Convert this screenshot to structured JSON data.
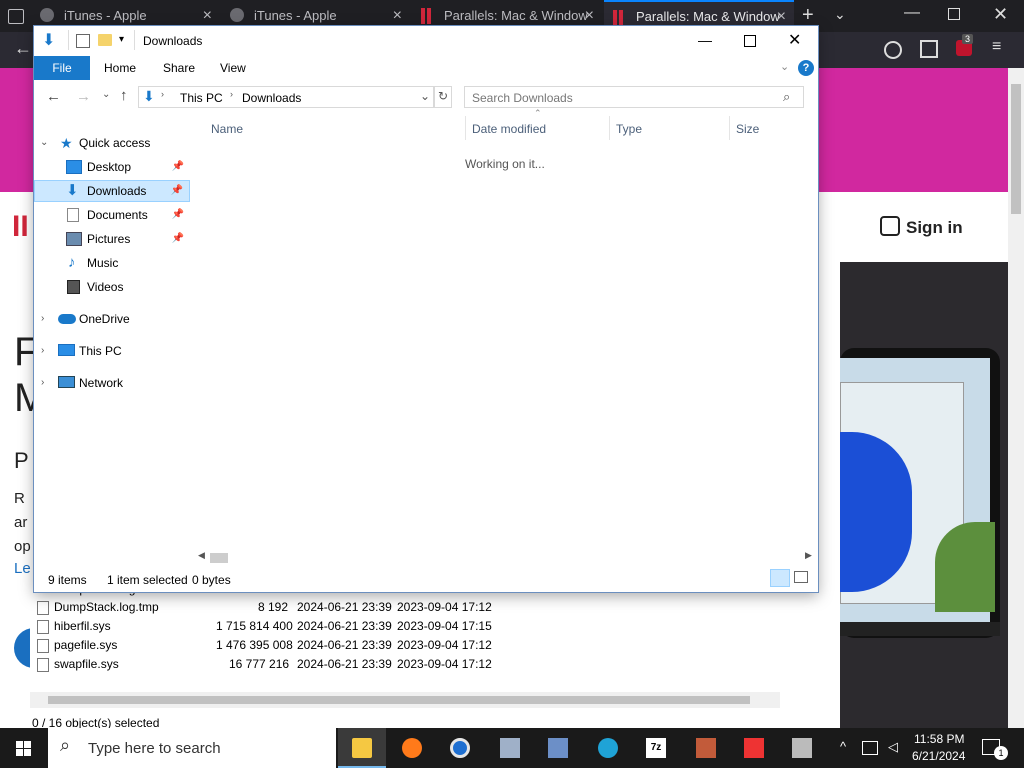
{
  "browser": {
    "tabs": [
      {
        "label": "iTunes - Apple",
        "icon": "apple-icon"
      },
      {
        "label": "iTunes - Apple",
        "icon": "apple-icon"
      },
      {
        "label": "Parallels: Mac & Window",
        "icon": "parallels-icon"
      },
      {
        "label": "Parallels: Mac & Window",
        "icon": "parallels-icon"
      }
    ],
    "badge_count": "3"
  },
  "webpage": {
    "sign_in": "Sign in",
    "left_letters": [
      "F",
      "M",
      "P",
      "R",
      "ar",
      "op",
      "Le"
    ]
  },
  "under_window": {
    "rows": [
      {
        "name": "DumpStack.log",
        "size": "8 192",
        "date1": "2024-06-21 23:39",
        "date2": "2023-09-04 17:12"
      },
      {
        "name": "DumpStack.log.tmp",
        "size": "8 192",
        "date1": "2024-06-21 23:39",
        "date2": "2023-09-04 17:12"
      },
      {
        "name": "hiberfil.sys",
        "size": "1 715 814 400",
        "date1": "2024-06-21 23:39",
        "date2": "2023-09-04 17:15"
      },
      {
        "name": "pagefile.sys",
        "size": "1 476 395 008",
        "date1": "2024-06-21 23:39",
        "date2": "2023-09-04 17:12"
      },
      {
        "name": "swapfile.sys",
        "size": "16 777 216",
        "date1": "2024-06-21 23:39",
        "date2": "2023-09-04 17:12"
      }
    ],
    "status": "0 / 16 object(s) selected"
  },
  "explorer": {
    "title": "Downloads",
    "ribbon_tabs": {
      "file": "File",
      "home": "Home",
      "share": "Share",
      "view": "View"
    },
    "path": {
      "root": "This PC",
      "folder": "Downloads"
    },
    "search_placeholder": "Search Downloads",
    "nav": {
      "quick_access": "Quick access",
      "desktop": "Desktop",
      "downloads": "Downloads",
      "documents": "Documents",
      "pictures": "Pictures",
      "music": "Music",
      "videos": "Videos",
      "onedrive": "OneDrive",
      "this_pc": "This PC",
      "network": "Network"
    },
    "columns": {
      "name": "Name",
      "date": "Date modified",
      "type": "Type",
      "size": "Size"
    },
    "working": "Working on it...",
    "status": {
      "items": "9 items",
      "selected": "1 item selected",
      "bytes": "0 bytes"
    }
  },
  "taskbar": {
    "search_placeholder": "Type here to search",
    "time": "11:58 PM",
    "date": "6/21/2024",
    "notification_count": "1"
  },
  "colors": {
    "accent": "#1979ca",
    "pink": "#d1289f",
    "selection": "#cce8ff"
  }
}
